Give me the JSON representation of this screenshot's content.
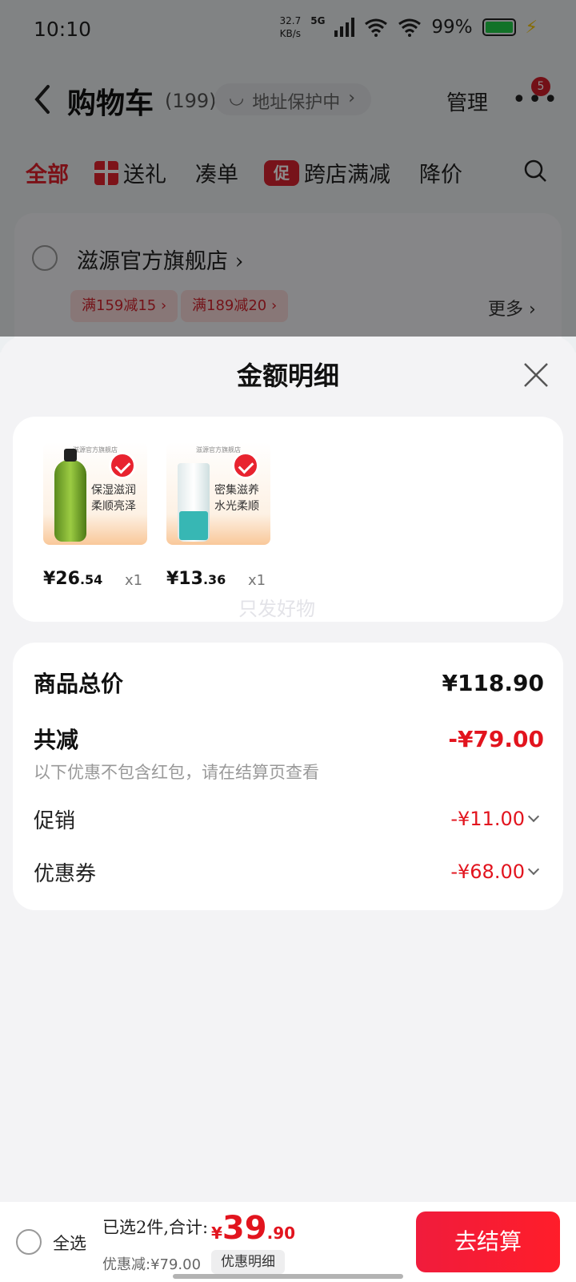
{
  "status": {
    "time": "10:10",
    "net_speed": "32.7",
    "net_unit": "KB/s",
    "network": "5G",
    "battery": "99%"
  },
  "nav": {
    "title": "购物车",
    "count": "(199)",
    "address_chip": "地址保护中",
    "manage": "管理",
    "badge": "5"
  },
  "tabs": [
    "全部",
    "送礼",
    "凑单",
    "跨店满减",
    "降价"
  ],
  "promo_icon_label": "促",
  "store": {
    "name": "滋源官方旗舰店",
    "coupons": [
      "满159减15",
      "满189减20"
    ],
    "more": "更多"
  },
  "sheet": {
    "title": "金额明细",
    "items": [
      {
        "price_int": "¥26",
        "price_dec": ".54",
        "qty": "x1",
        "label": "保湿滋润柔顺亮泽",
        "brand": "滋源官方旗舰店"
      },
      {
        "price_int": "¥13",
        "price_dec": ".36",
        "qty": "x1",
        "label": "密集滋养水光柔顺",
        "brand": "滋源官方旗舰店"
      }
    ],
    "watermark": "只发好物",
    "summary": {
      "total_label": "商品总价",
      "total_value": "¥118.90",
      "reduce_label": "共减",
      "reduce_value": "-¥79.00",
      "note": "以下优惠不包含红包，请在结算页查看",
      "promo_label": "促销",
      "promo_value": "-¥11.00",
      "coupon_label": "优惠券",
      "coupon_value": "-¥68.00"
    }
  },
  "checkout": {
    "select_all": "全选",
    "selected": "已选2件,合计:",
    "currency": "¥",
    "total_int": "39",
    "total_dec": ".90",
    "discount": "优惠减:¥79.00",
    "detail": "优惠明细",
    "button": "去结算"
  },
  "colors": {
    "accent": "#e2141e",
    "button": "#ff1d2a"
  }
}
